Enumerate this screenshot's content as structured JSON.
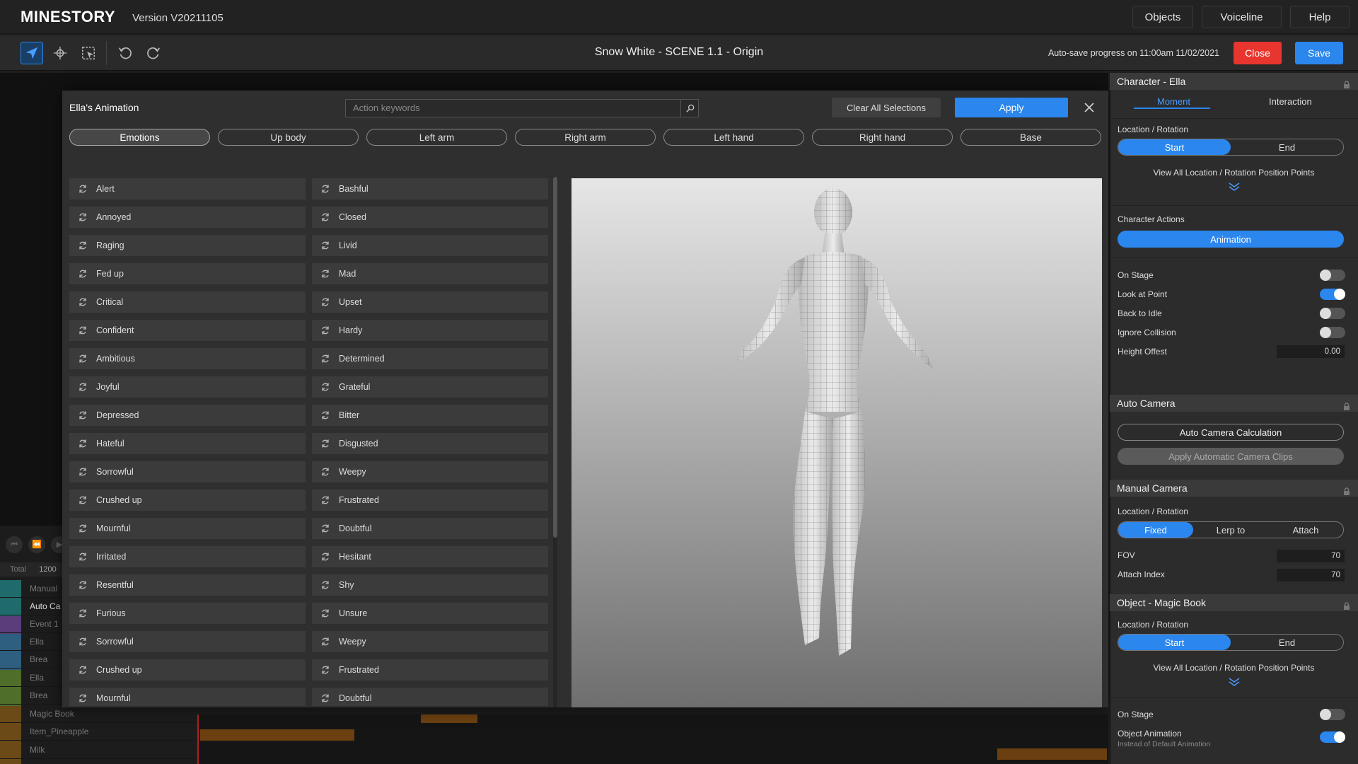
{
  "app": {
    "logo": "MINESTORY",
    "version": "Version V20211105",
    "nav": [
      "Objects",
      "Voiceline",
      "Help"
    ]
  },
  "toolbar": {
    "tools": [
      "pointer-icon",
      "move-icon",
      "select-region-icon",
      "undo-icon",
      "redo-icon"
    ],
    "scene_title": "Snow White - SCENE 1.1 - Origin",
    "autosave": "Auto-save progress on 11:00am 11/02/2021",
    "close_label": "Close",
    "save_label": "Save"
  },
  "timeline": {
    "total_label": "Total",
    "total_value": "1200",
    "tracks": [
      "Manual",
      "Auto Ca",
      "Event 1",
      "Ella",
      "Brea",
      "Ella",
      "Brea",
      "Magic Book",
      "Item_Pineapple",
      "Milk"
    ]
  },
  "modal": {
    "title": "Ella's Animation",
    "search_placeholder": "Action keywords",
    "clear_label": "Clear All Selections",
    "apply_label": "Apply",
    "categories": [
      "Emotions",
      "Up body",
      "Left arm",
      "Right arm",
      "Left hand",
      "Right hand",
      "Base"
    ],
    "active_category": "Emotions",
    "left_column": [
      "Alert",
      "Annoyed",
      "Raging",
      "Fed up",
      "Critical",
      "Confident",
      "Ambitious",
      "Joyful",
      "Depressed",
      "Hateful",
      "Sorrowful",
      "Crushed up",
      "Mournful",
      "Irritated",
      "Resentful",
      "Furious",
      "Sorrowful",
      "Crushed up",
      "Mournful"
    ],
    "right_column": [
      "Bashful",
      "Closed",
      "Livid",
      "Mad",
      "Upset",
      "Hardy",
      "Determined",
      "Grateful",
      "Bitter",
      "Disgusted",
      "Weepy",
      "Frustrated",
      "Doubtful",
      "Hesitant",
      "Shy",
      "Unsure",
      "Weepy",
      "Frustrated",
      "Doubtful"
    ]
  },
  "panel": {
    "character": {
      "header": "Character  -  Ella",
      "tabs": [
        "Moment",
        "Interaction"
      ],
      "location_label": "Location / Rotation",
      "seg": [
        "Start",
        "End"
      ],
      "view_all": "View All Location / Rotation Position Points",
      "actions_label": "Character Actions",
      "animation_label": "Animation",
      "toggles": [
        {
          "label": "On Stage",
          "on": false
        },
        {
          "label": "Look at Point",
          "on": true
        },
        {
          "label": "Back to Idle",
          "on": false
        },
        {
          "label": "Ignore Collision",
          "on": false
        }
      ],
      "height_label": "Height Offest",
      "height_value": "0.00"
    },
    "auto_camera": {
      "header": "Auto Camera",
      "calc_label": "Auto Camera Calculation",
      "apply_label": "Apply Automatic Camera Clips"
    },
    "manual_camera": {
      "header": "Manual Camera",
      "location_label": "Location / Rotation",
      "seg": [
        "Fixed",
        "Lerp to",
        "Attach"
      ],
      "fov_label": "FOV",
      "fov_value": "70",
      "attach_label": "Attach Index",
      "attach_value": "70"
    },
    "object": {
      "header": "Object  -  Magic Book",
      "location_label": "Location / Rotation",
      "seg": [
        "Start",
        "End"
      ],
      "view_all": "View All Location / Rotation Position Points",
      "on_stage_label": "On Stage",
      "on_stage": false,
      "anim_label": "Object Animation",
      "anim_sub": "Instead of Default Animation",
      "anim_on": true
    }
  },
  "colors": {
    "accent": "#2b86ee",
    "close": "#e8352e"
  }
}
